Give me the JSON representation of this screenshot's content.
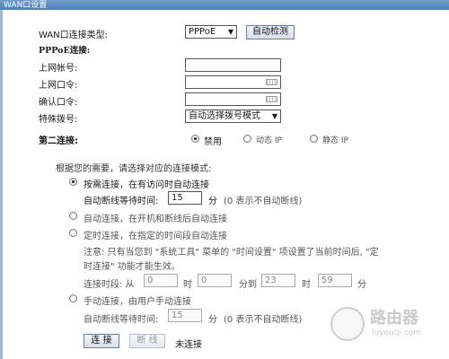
{
  "window": {
    "title": "WAN口设置"
  },
  "form": {
    "conn_type_label": "WAN口连接类型:",
    "conn_type_value": "PPPoE",
    "detect_button": "自动检测",
    "pppoe_heading": "PPPoE连接:",
    "username_label": "上网帐号:",
    "username_value": "",
    "password_label": "上网口令:",
    "password_value": "",
    "confirm_label": "确认口令:",
    "confirm_value": "",
    "dial_label": "特殊拨号:",
    "dial_value": "自动选择拨号模式",
    "second_label": "第二连接:",
    "second_options": [
      "禁用",
      "动态 IP",
      "静态 IP"
    ],
    "second_selected": "禁用"
  },
  "modes": {
    "intro": "根据您的需要，请选择对应的连接模式:",
    "on_demand": "按需连接，在有访问时自动连接",
    "on_demand_wait_label": "自动断线等待时间:",
    "on_demand_wait_value": "15",
    "on_demand_unit": "分",
    "on_demand_note": "(0 表示不自动断线)",
    "auto": "自动连接，在开机和断线后自动连接",
    "timed": "定时连接，在指定的时间段自动连接",
    "timed_note_line1": "注意: 只有当您到 \"系统工具\" 菜单的 \"时间设置\" 项设置了当前时间后, \"定",
    "timed_note_line2": "时连接\" 功能才能生效。",
    "period_label": "连接时段: 从",
    "from_hour": "0",
    "hour_label1": "时",
    "from_min": "0",
    "min_to_label": "分到",
    "to_hour": "23",
    "hour_label2": "时",
    "to_min": "59",
    "min_label": "分",
    "manual": "手动连接，由用户手动连接",
    "manual_wait_label": "自动断线等待时间:",
    "manual_wait_value": "15",
    "manual_unit": "分",
    "manual_note": "(0 表示不自动断线)",
    "selected": "on_demand"
  },
  "actions": {
    "connect": "连 接",
    "disconnect": "断 线",
    "status": "未连接"
  },
  "watermark": {
    "text": "路由器",
    "url": "luyouqi.com"
  }
}
